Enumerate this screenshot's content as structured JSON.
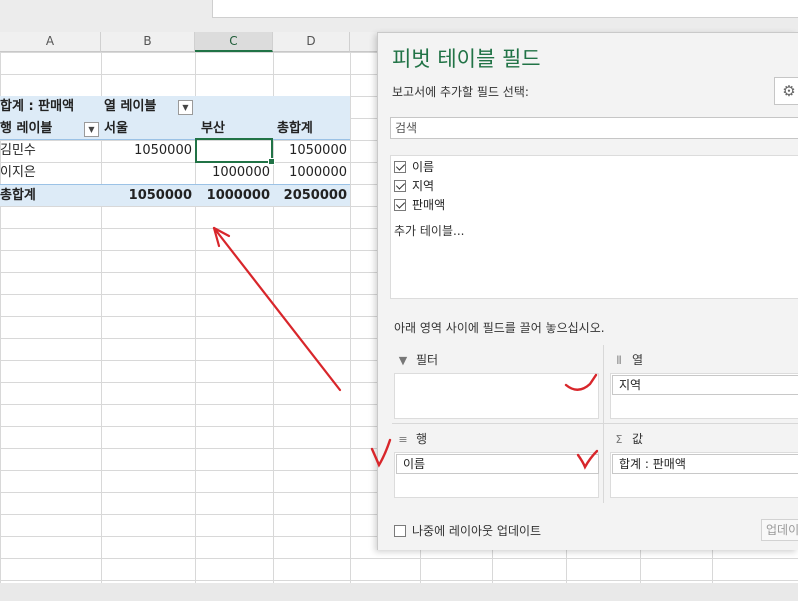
{
  "sheet": {
    "columns": [
      "A",
      "B",
      "C",
      "D"
    ],
    "pivot": {
      "corner_label": "합계 : 판매액",
      "col_labels_caption": "열 레이블",
      "row_labels_caption": "행 레이블",
      "headers": [
        "서울",
        "부산",
        "총합계"
      ],
      "rows": [
        {
          "name": "김민수",
          "seoul": "1050000",
          "busan": "",
          "total": "1050000"
        },
        {
          "name": "이지은",
          "seoul": "",
          "busan": "1000000",
          "total": "1000000"
        }
      ],
      "grand_total": {
        "name": "총합계",
        "seoul": "1050000",
        "busan": "1000000",
        "total": "2050000"
      },
      "band_color": "#ddebf7"
    }
  },
  "pane": {
    "title": "피벗 테이블 필드",
    "subtitle": "보고서에 추가할 필드 선택:",
    "search_placeholder": "검색",
    "fields": [
      {
        "label": "이름",
        "checked": true
      },
      {
        "label": "지역",
        "checked": true
      },
      {
        "label": "판매액",
        "checked": true
      }
    ],
    "more_tables": "추가 테이블...",
    "drag_hint": "아래 영역 사이에 필드를 끌어 놓으십시오.",
    "areas": {
      "filter": {
        "label": "필터",
        "icon": "filter-icon"
      },
      "columns": {
        "label": "열",
        "icon": "columns-icon",
        "item": "지역"
      },
      "rows": {
        "label": "행",
        "icon": "rows-icon",
        "item": "이름"
      },
      "values": {
        "label": "값",
        "icon": "sigma-icon",
        "item": "합계 : 판매액"
      }
    },
    "defer_label": "나중에 레이아웃 업데이트",
    "update_button": "업데이트"
  },
  "colors": {
    "accent": "#217346",
    "annotation": "#d8262b"
  }
}
